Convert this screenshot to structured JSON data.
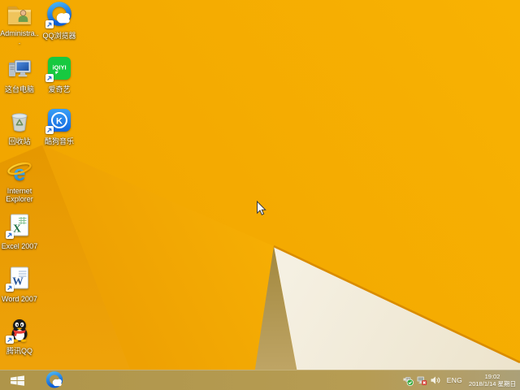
{
  "desktop": {
    "icons": [
      {
        "label": "Administra...",
        "icon": "user-folder-icon"
      },
      {
        "label": "QQ浏览器",
        "icon": "qq-browser-icon"
      },
      {
        "label": "这台电脑",
        "icon": "this-pc-icon"
      },
      {
        "label": "爱奇艺",
        "icon": "iqiyi-icon"
      },
      {
        "label": "回收站",
        "icon": "recycle-bin-icon"
      },
      {
        "label": "酷狗音乐",
        "icon": "kugou-music-icon"
      },
      {
        "label": "Internet Explorer",
        "icon": "internet-explorer-icon"
      },
      {
        "label": "Excel 2007",
        "icon": "excel-icon"
      },
      {
        "label": "Word 2007",
        "icon": "word-icon"
      },
      {
        "label": "腾讯QQ",
        "icon": "tencent-qq-icon"
      }
    ]
  },
  "taskbar": {
    "start_icon": "windows-logo-icon",
    "pinned": [
      {
        "icon": "qq-browser-icon"
      }
    ],
    "tray": {
      "icons": [
        "usb-safely-remove-icon",
        "network-disconnected-icon",
        "volume-icon"
      ],
      "language": "ENG",
      "time": "19:02",
      "date": "2018/1/14 星期日"
    }
  },
  "colors": {
    "wallpaper_orange": "#F5AB00",
    "wallpaper_orange_dark": "#E79A00",
    "wallpaper_cream": "#F2EBDB",
    "wallpaper_tan": "#B3984F",
    "fold_edge": "#D98C00",
    "taskbar_tan": "#B49A52",
    "label_text": "#FFFFFF"
  }
}
